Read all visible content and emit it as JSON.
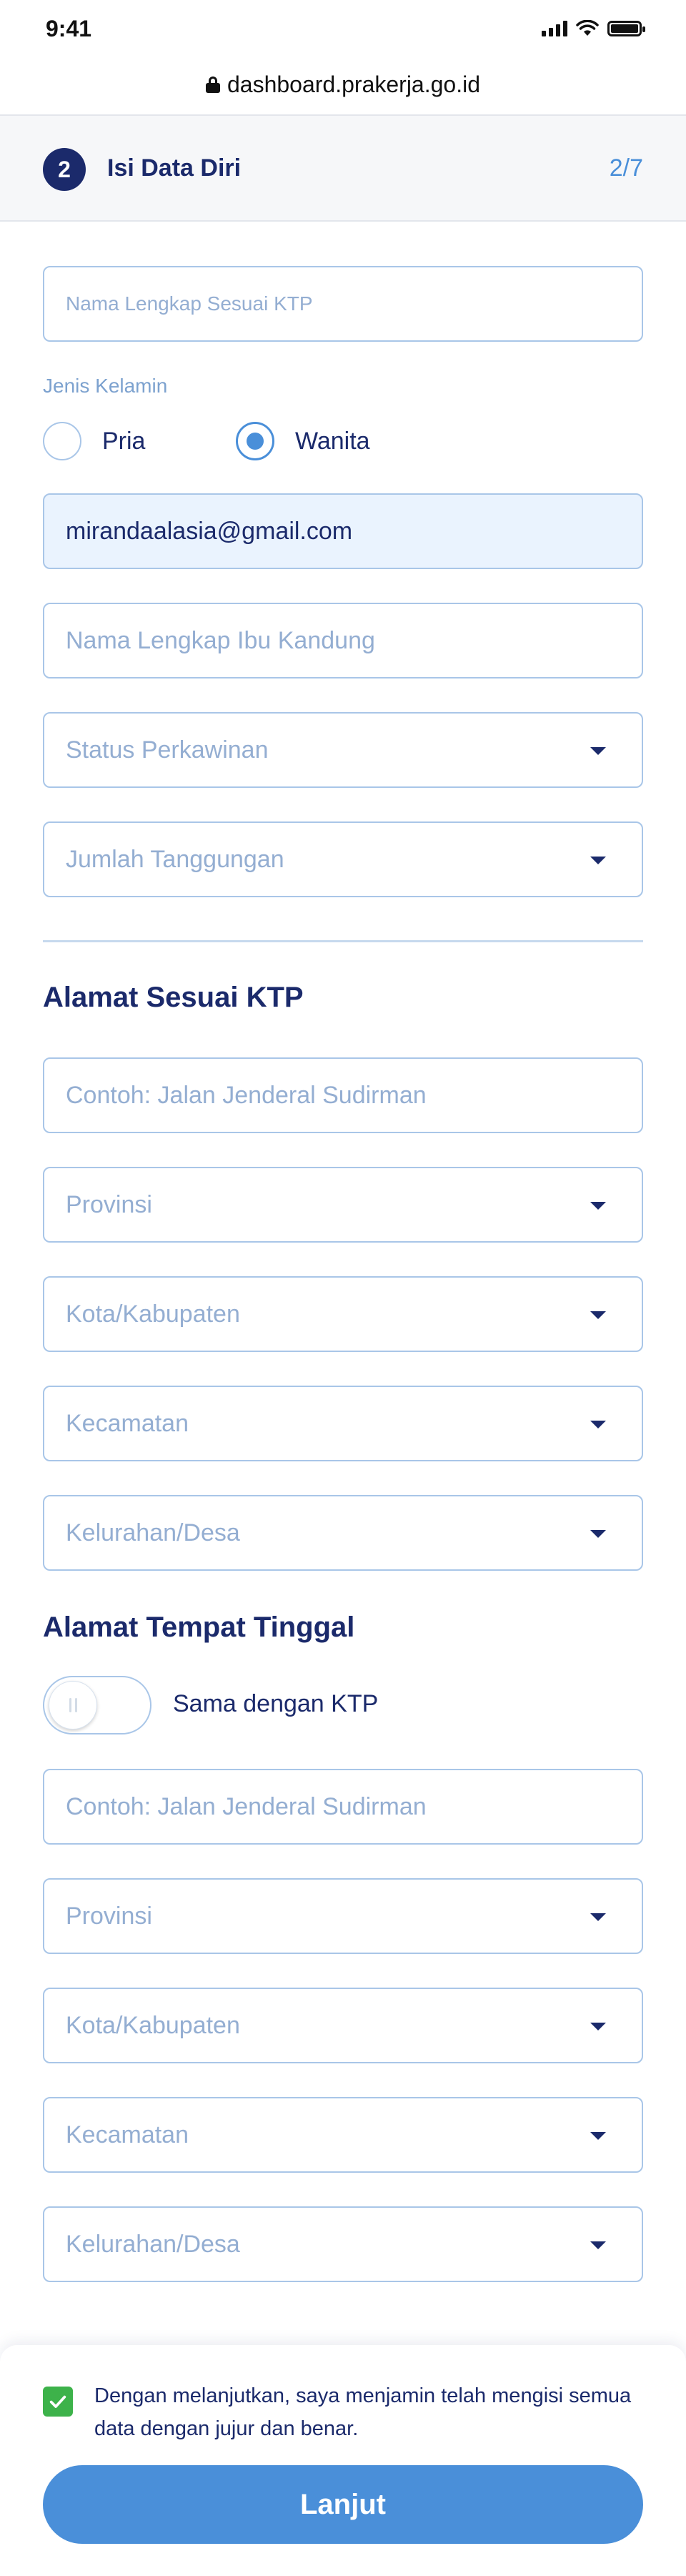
{
  "status_bar": {
    "time": "9:41"
  },
  "browser": {
    "url": "dashboard.prakerja.go.id"
  },
  "step": {
    "number": "2",
    "title": "Isi Data Diri",
    "progress": "2/7"
  },
  "form": {
    "full_name_placeholder": "Nama Lengkap Sesuai KTP",
    "gender": {
      "label": "Jenis Kelamin",
      "options": [
        "Pria",
        "Wanita"
      ],
      "selected": "Wanita"
    },
    "email_value": "mirandaalasia@gmail.com",
    "mother_name_placeholder": "Nama Lengkap Ibu Kandung",
    "marital_status_placeholder": "Status Perkawinan",
    "dependents_placeholder": "Jumlah Tanggungan"
  },
  "ktp_address": {
    "title": "Alamat Sesuai KTP",
    "street_placeholder": "Contoh: Jalan Jenderal Sudirman",
    "province_placeholder": "Provinsi",
    "city_placeholder": "Kota/Kabupaten",
    "district_placeholder": "Kecamatan",
    "village_placeholder": "Kelurahan/Desa"
  },
  "residence_address": {
    "title": "Alamat Tempat Tinggal",
    "same_as_ktp_label": "Sama dengan KTP",
    "same_as_ktp_enabled": false,
    "street_placeholder": "Contoh: Jalan Jenderal Sudirman",
    "province_placeholder": "Provinsi",
    "city_placeholder": "Kota/Kabupaten",
    "district_placeholder": "Kecamatan",
    "village_placeholder": "Kelurahan/Desa"
  },
  "footer": {
    "consent_checked": true,
    "consent_text": "Dengan melanjutkan, saya menjamin telah mengisi semua data dengan jujur dan benar.",
    "submit_label": "Lanjut"
  },
  "colors": {
    "primary_navy": "#1b2a6b",
    "accent_blue": "#4a8fd9",
    "field_border": "#a9c6e8",
    "placeholder": "#94aed2",
    "check_green": "#3db24a"
  }
}
